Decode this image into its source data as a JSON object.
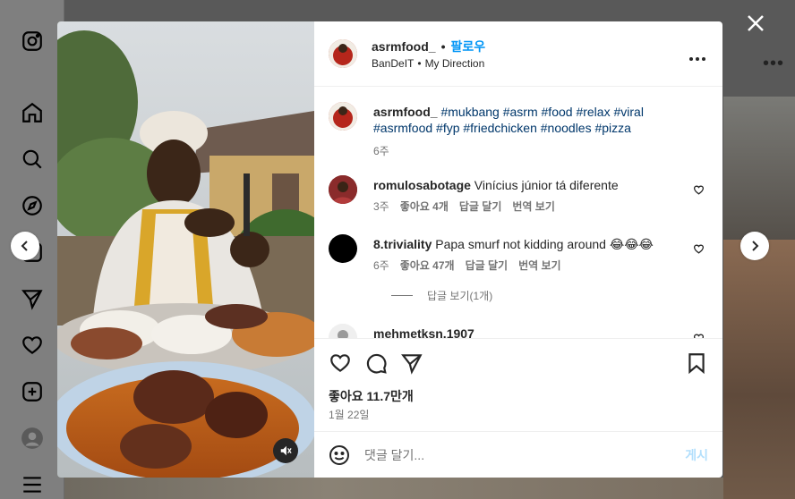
{
  "colors": {
    "accent": "#0095f6",
    "hashtag": "#00376b",
    "muted": "#737373"
  },
  "nav": {
    "icons": [
      "instagram-icon",
      "home-icon",
      "search-icon",
      "explore-icon",
      "reels-icon",
      "messages-icon",
      "notifications-icon",
      "create-icon",
      "profile-avatar",
      "menu-icon"
    ]
  },
  "post": {
    "username": "asrmfood_",
    "separator": "•",
    "follow_label": "팔로우",
    "audio_artist": "BanDeIT",
    "audio_sep": "•",
    "audio_title": "My Direction",
    "caption_user": "asrmfood_",
    "caption_tags": "#mukbang #asrm #food #relax #viral #asrmfood #fyp #friedchicken #noodles #pizza",
    "caption_time": "6주"
  },
  "comments": [
    {
      "user": "romulosabotage",
      "text": "Vinícius júnior tá diferente",
      "time": "3주",
      "likes": "좋아요 4개",
      "reply": "답글 달기",
      "translate": "번역 보기"
    },
    {
      "user": "8.triviality",
      "text": "Papa smurf not kidding around 😂😂😂",
      "time": "6주",
      "likes": "좋아요 47개",
      "reply": "답글 달기",
      "translate": "번역 보기"
    },
    {
      "user": "mehmetksn.1907",
      "text": "",
      "time": "",
      "likes": "",
      "reply": "",
      "translate": ""
    }
  ],
  "view_replies": "답글 보기(1개)",
  "likes_count": "좋아요 11.7만개",
  "post_date": "1월 22일",
  "comment_placeholder": "댓글 달기...",
  "post_button": "게시"
}
